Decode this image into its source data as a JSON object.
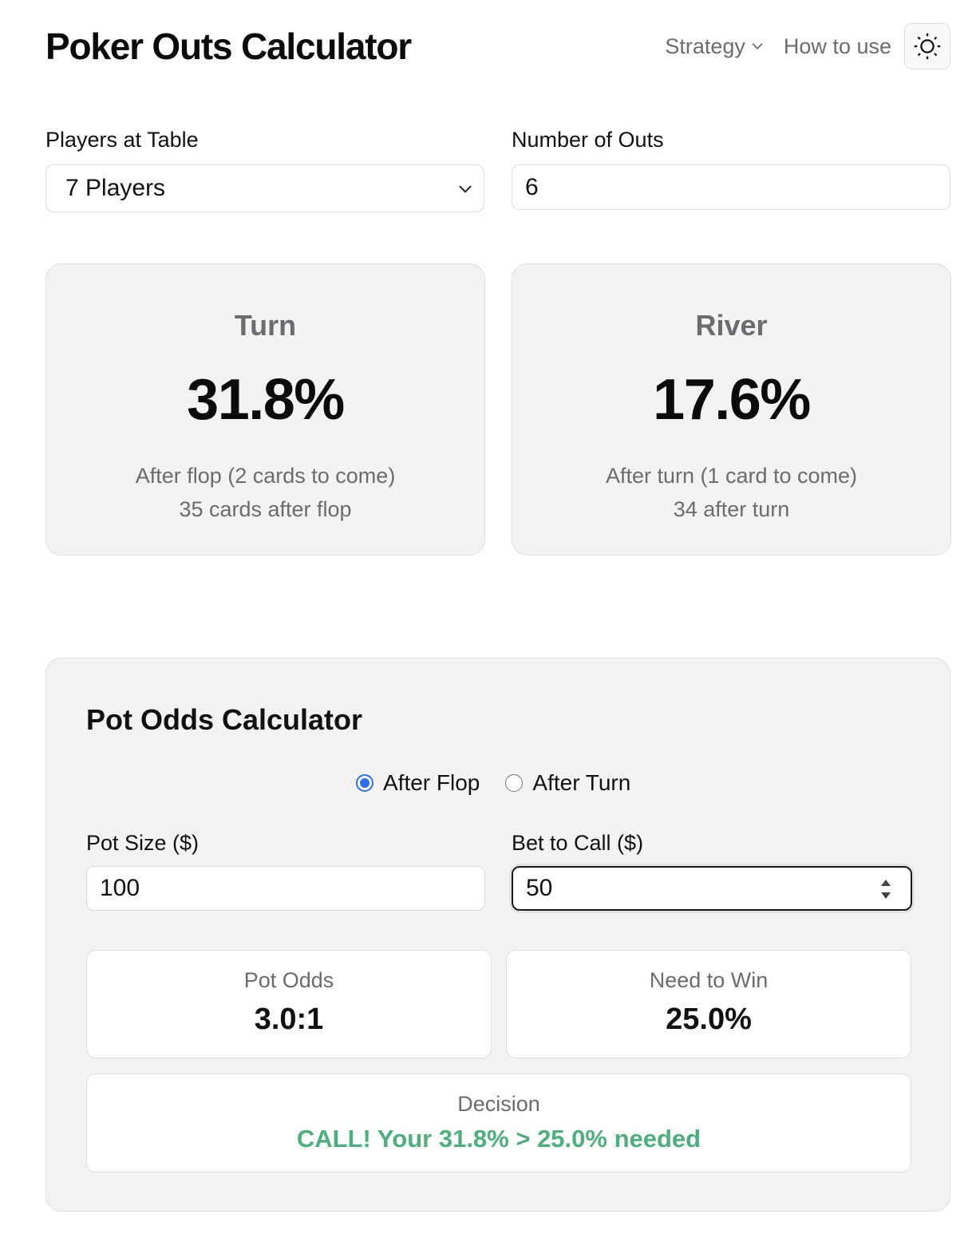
{
  "header": {
    "title": "Poker Outs Calculator",
    "nav_strategy": "Strategy",
    "nav_how_to_use": "How to use",
    "theme_icon": "sun-icon"
  },
  "inputs": {
    "players_label": "Players at Table",
    "players_value": "7 Players",
    "outs_label": "Number of Outs",
    "outs_value": "6"
  },
  "results": {
    "turn": {
      "title": "Turn",
      "percent": "31.8%",
      "line1": "After flop (2 cards to come)",
      "line2": "35 cards after flop"
    },
    "river": {
      "title": "River",
      "percent": "17.6%",
      "line1": "After turn (1 card to come)",
      "line2": "34 after turn"
    }
  },
  "pot_odds": {
    "title": "Pot Odds Calculator",
    "radio_options": [
      "After Flop",
      "After Turn"
    ],
    "selected_option": "After Flop",
    "pot_size_label": "Pot Size ($)",
    "pot_size_value": "100",
    "bet_label": "Bet to Call ($)",
    "bet_value": "50",
    "pot_odds_label": "Pot Odds",
    "pot_odds_value": "3.0:1",
    "need_to_win_label": "Need to Win",
    "need_to_win_value": "25.0%",
    "decision_label": "Decision",
    "decision_value": "CALL! Your 31.8% > 25.0% needed"
  },
  "colors": {
    "accent_blue": "#2f6fe8",
    "decision_green": "#4caf7d",
    "muted_text": "#6b6b70",
    "card_background": "#f3f3f3"
  }
}
